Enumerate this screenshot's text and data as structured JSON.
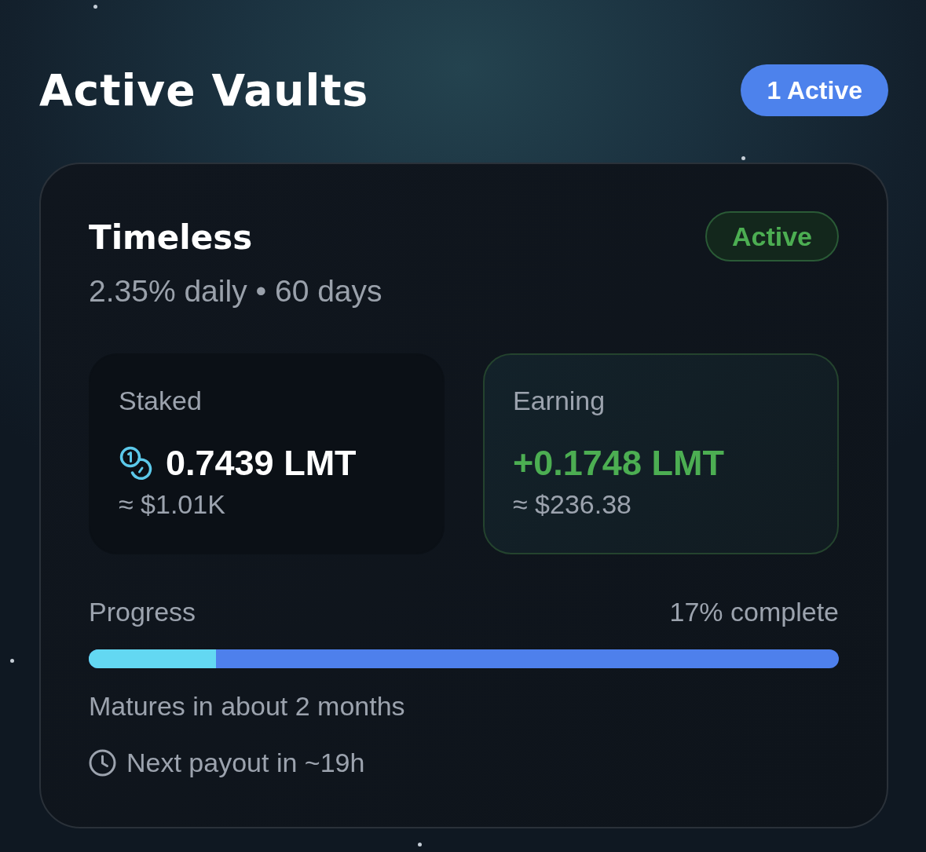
{
  "header": {
    "title": "Active Vaults",
    "count_badge": "1 Active"
  },
  "vaults": [
    {
      "name": "Timeless",
      "status": {
        "label": "Active",
        "kind": "success"
      },
      "terms": "2.35% daily • 60 days",
      "stats": [
        {
          "kind": "neutral",
          "label": "Staked",
          "value": "0.7439 LMT",
          "usd": "≈ $1.01K"
        },
        {
          "kind": "positive",
          "label": "Earning",
          "value": "+0.1748 LMT",
          "usd": "≈ $236.38"
        }
      ],
      "progress": {
        "label": "Progress",
        "reading": "17% complete",
        "level": 0.17
      },
      "maturity": "Matures in about 2 months",
      "next_payout": "Next payout in ~19h"
    }
  ]
}
